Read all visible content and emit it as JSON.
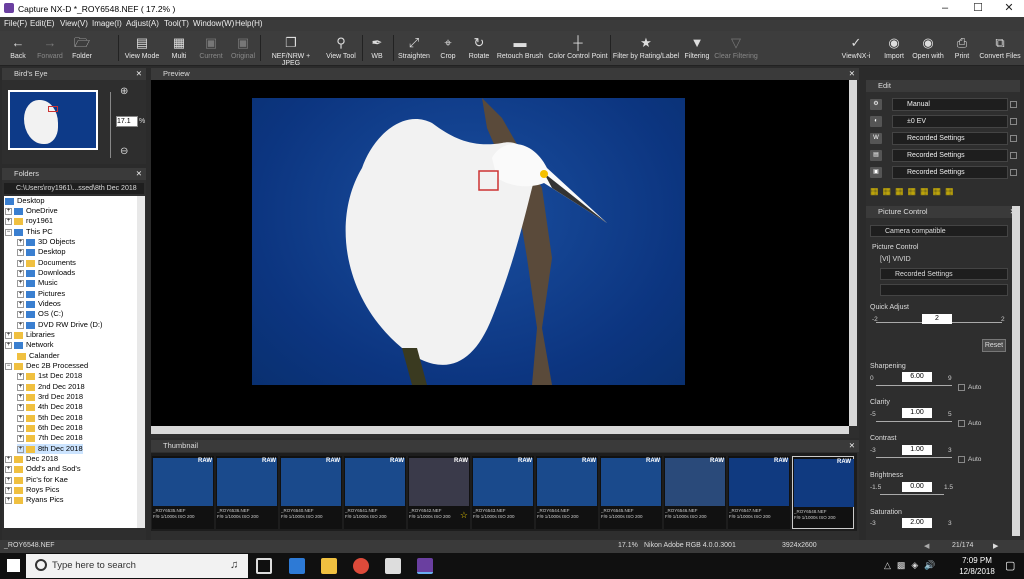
{
  "title": "Capture NX-D  *_ROY6548.NEF ( 17.2% )",
  "menu": [
    "File(F)",
    "Edit(E)",
    "View(V)",
    "Image(I)",
    "Adjust(A)",
    "Tool(T)",
    "Window(W)",
    "Help(H)"
  ],
  "toolbar": {
    "back": "Back",
    "forward": "Forward",
    "folder": "Folder",
    "view_mode": "View Mode",
    "multi": "Multi",
    "current": "Current",
    "original": "Original",
    "nef": "NEF/NRW + JPEG",
    "view_tool": "View Tool",
    "wb": "WB",
    "straighten": "Straighten",
    "crop": "Crop",
    "rotate": "Rotate",
    "retouch": "Retouch Brush",
    "ccp": "Color Control Point",
    "filter_rating": "Filter by Rating/Label",
    "filtering": "Filtering",
    "clear_filter": "Clear Filtering",
    "viewnx": "ViewNX-i",
    "import": "Import",
    "open_with": "Open with",
    "print": "Print",
    "convert": "Convert Files"
  },
  "birds_eye": {
    "title": "Bird's Eye",
    "zoom": "17.1",
    "pct": "%"
  },
  "folders": {
    "title": "Folders",
    "path": "C:\\Users\\roy1961\\...ssed\\8th Dec 2018",
    "items": [
      "Desktop",
      "OneDrive",
      "roy1961",
      "This PC",
      "3D Objects",
      "Desktop",
      "Documents",
      "Downloads",
      "Music",
      "Pictures",
      "Videos",
      "OS (C:)",
      "DVD RW Drive (D:)",
      "Libraries",
      "Network",
      "Calander",
      "Dec 2B Processed",
      "1st Dec 2018",
      "2nd Dec 2018",
      "3rd Dec 2018",
      "4th Dec 2018",
      "5th Dec 2018",
      "6th Dec 2018",
      "7th Dec 2018",
      "8th Dec 2018",
      "Dec 2018",
      "Odd's and Sod's",
      "Pic's for Kae",
      "Roys Pics",
      "Ryans Pics"
    ]
  },
  "preview": {
    "title": "Preview"
  },
  "thumbnail": {
    "title": "Thumbnail",
    "raw": "RAW",
    "captions": [
      [
        "_ROY6535.NEF",
        "F/9 1/1000s ISO 200"
      ],
      [
        "_ROY6536.NEF",
        "F/9 1/1000s ISO 200"
      ],
      [
        "_ROY6540.NEF",
        "F/9 1/1000s ISO 200"
      ],
      [
        "_ROY6541.NEF",
        "F/9 1/1000s ISO 200"
      ],
      [
        "_ROY6542.NEF",
        "F/9 1/1000s ISO 200"
      ],
      [
        "_ROY6543.NEF",
        "F/9 1/1000s ISO 200"
      ],
      [
        "_ROY6544.NEF",
        "F/9 1/1000s ISO 200"
      ],
      [
        "_ROY6545.NEF",
        "F/9 1/1000s ISO 200"
      ],
      [
        "_ROY6546.NEF",
        "F/9 1/1000s ISO 200"
      ],
      [
        "_ROY6547.NEF",
        "F/9 1/1000s ISO 200"
      ],
      [
        "_ROY6548.NEF",
        "F/9 1/1000s ISO 200"
      ]
    ]
  },
  "edit": {
    "title": "Edit",
    "rows": [
      "Manual",
      "±0 EV",
      "Recorded Settings",
      "Recorded Settings",
      "Recorded Settings"
    ]
  },
  "picture_control": {
    "title": "Picture Control",
    "mode": "Camera compatible",
    "pc_label": "Picture Control",
    "pc_value": "[VI] VIVID",
    "recorded": "Recorded Settings",
    "quick_adjust": "Quick Adjust",
    "qa_min": "-2",
    "qa_max": "2",
    "qa_val": "2",
    "reset": "Reset",
    "sharpening": "Sharpening",
    "sh_min": "0",
    "sh_max": "9",
    "sh_val": "6.00",
    "clarity": "Clarity",
    "cl_min": "-5",
    "cl_max": "5",
    "cl_val": "1.00",
    "contrast": "Contrast",
    "co_min": "-3",
    "co_max": "3",
    "co_val": "1.00",
    "brightness": "Brightness",
    "br_min": "-1.5",
    "br_max": "1.5",
    "br_val": "0.00",
    "saturation": "Saturation",
    "sa_min": "-3",
    "sa_max": "3",
    "sa_val": "2.00",
    "auto": "Auto"
  },
  "status": {
    "file": "_ROY6548.NEF",
    "zoom": "17.1%",
    "profile": "Nikon Adobe RGB 4.0.0.3001",
    "size": "3924x2600",
    "count": "21/174"
  },
  "taskbar": {
    "search": "Type here to search",
    "time": "7:09 PM",
    "date": "12/8/2018"
  }
}
